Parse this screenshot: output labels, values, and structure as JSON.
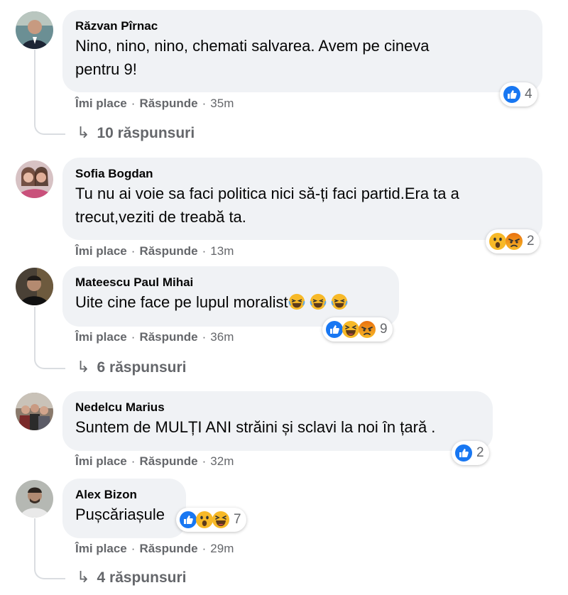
{
  "comments": [
    {
      "author": "Răzvan Pîrnac",
      "text": "Nino, nino, nino, chemati salvarea. Avem pe cineva\npentru 9!",
      "like_label": "Îmi place",
      "reply_label": "Răspunde",
      "time": "35m",
      "reactions": [
        "like-icon"
      ],
      "reaction_count": "4",
      "replies_label": "10 răspunsuri"
    },
    {
      "author": "Sofia Bogdan",
      "text": "Tu nu ai voie sa faci politica nici să-ți faci partid.Era ta a\ntrecut,veziti de treabă ta.",
      "like_label": "Îmi place",
      "reply_label": "Răspunde",
      "time": "13m",
      "reactions": [
        "wow-icon",
        "angry-icon"
      ],
      "reaction_count": "2"
    },
    {
      "author": "Mateescu Paul Mihai",
      "text": "Uite cine face pe lupul moralist",
      "inline_emojis": [
        "laugh-emoji",
        "laugh-emoji",
        "laugh-emoji"
      ],
      "like_label": "Îmi place",
      "reply_label": "Răspunde",
      "time": "36m",
      "reactions": [
        "like-icon",
        "haha-icon",
        "angry-icon"
      ],
      "reaction_count": "9",
      "replies_label": "6 răspunsuri"
    },
    {
      "author": "Nedelcu Marius",
      "text": "Suntem de MULȚI ANI străini și sclavi la noi în țară .",
      "like_label": "Îmi place",
      "reply_label": "Răspunde",
      "time": "32m",
      "reactions": [
        "like-icon"
      ],
      "reaction_count": "2"
    },
    {
      "author": "Alex Bizon",
      "text": "Pușcăriașule",
      "like_label": "Îmi place",
      "reply_label": "Răspunde",
      "time": "29m",
      "reactions": [
        "like-icon",
        "wow-icon",
        "haha-icon"
      ],
      "reaction_count": "7",
      "replies_label": "4 răspunsuri"
    }
  ],
  "ui": {
    "separator": "·",
    "reply_arrow": "↳"
  },
  "colors": {
    "bubble": "#f0f2f5",
    "secondary_text": "#65676b",
    "like_blue": "#1877f2",
    "reaction_yellow": "#f7b928",
    "angry_orange": "#e9710f"
  }
}
